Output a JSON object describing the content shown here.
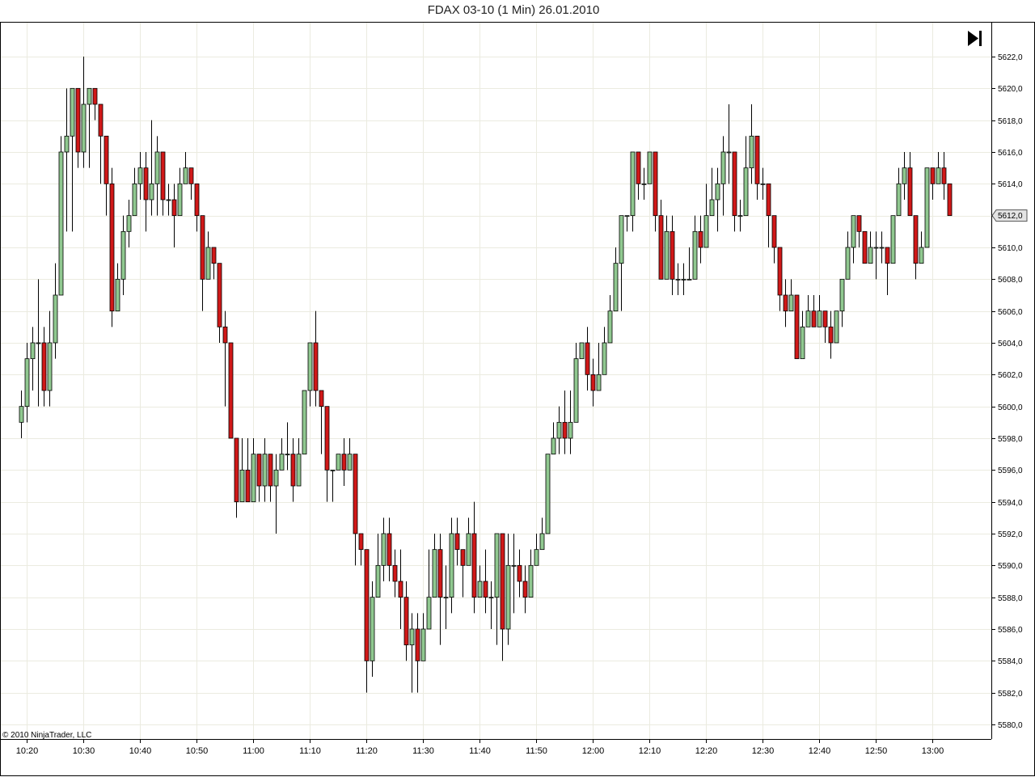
{
  "chart_data": {
    "type": "candlestick",
    "title": "FDAX 03-10 (1 Min)  26.01.2010",
    "copyright": "© 2010 NinjaTrader, LLC",
    "current_price_label": "5612,0",
    "current_price": 5612.0,
    "y_ticks": [
      "5580,0",
      "5582,0",
      "5584,0",
      "5586,0",
      "5588,0",
      "5590,0",
      "5592,0",
      "5594,0",
      "5596,0",
      "5598,0",
      "5600,0",
      "5602,0",
      "5604,0",
      "5606,0",
      "5608,0",
      "5610,0",
      "5612,0",
      "5614,0",
      "5616,0",
      "5618,0",
      "5620,0",
      "5622,0"
    ],
    "y_tick_values": [
      5580,
      5582,
      5584,
      5586,
      5588,
      5590,
      5592,
      5594,
      5596,
      5598,
      5600,
      5602,
      5604,
      5606,
      5608,
      5610,
      5612,
      5614,
      5616,
      5618,
      5620,
      5622
    ],
    "x_ticks": [
      "10:20",
      "10:30",
      "10:40",
      "10:50",
      "11:00",
      "11:10",
      "11:20",
      "11:30",
      "11:40",
      "11:50",
      "12:00",
      "12:10",
      "12:20",
      "12:30",
      "12:40",
      "12:50",
      "13:00"
    ],
    "x_tick_minutes": [
      620,
      630,
      640,
      650,
      660,
      670,
      680,
      690,
      700,
      710,
      720,
      730,
      740,
      750,
      760,
      770,
      780
    ],
    "ylim": [
      5579.5,
      5623.5
    ],
    "grid": true,
    "colors": {
      "up": "#90c890",
      "down": "#d01818",
      "wick": "#000000",
      "grid": "#ebebe0"
    },
    "candles": [
      [
        619,
        5599,
        5600,
        5598,
        5601
      ],
      [
        620,
        5600,
        5603,
        5599,
        5604
      ],
      [
        621,
        5603,
        5604,
        5601,
        5605
      ],
      [
        622,
        5604,
        5604,
        5600,
        5608
      ],
      [
        623,
        5604,
        5601,
        5600,
        5605
      ],
      [
        624,
        5601,
        5604,
        5600,
        5606
      ],
      [
        625,
        5604,
        5607,
        5603,
        5609
      ],
      [
        626,
        5607,
        5616,
        5607,
        5617
      ],
      [
        627,
        5616,
        5617,
        5611,
        5620
      ],
      [
        628,
        5617,
        5620,
        5611,
        5620
      ],
      [
        629,
        5620,
        5616,
        5615,
        5620
      ],
      [
        630,
        5616,
        5619,
        5615,
        5622
      ],
      [
        631,
        5619,
        5620,
        5615,
        5620
      ],
      [
        632,
        5620,
        5619,
        5618,
        5620
      ],
      [
        633,
        5619,
        5617,
        5614,
        5619
      ],
      [
        634,
        5617,
        5614,
        5612,
        5617
      ],
      [
        635,
        5614,
        5606,
        5605,
        5615
      ],
      [
        636,
        5606,
        5608,
        5606,
        5609
      ],
      [
        637,
        5608,
        5611,
        5607,
        5612
      ],
      [
        638,
        5611,
        5612,
        5610,
        5613
      ],
      [
        639,
        5612,
        5614,
        5612,
        5615
      ],
      [
        640,
        5614,
        5615,
        5613,
        5616
      ],
      [
        641,
        5615,
        5613,
        5611,
        5616
      ],
      [
        642,
        5613,
        5614,
        5612,
        5618
      ],
      [
        643,
        5614,
        5616,
        5612,
        5617
      ],
      [
        644,
        5616,
        5613,
        5612,
        5616
      ],
      [
        645,
        5613,
        5613,
        5612,
        5614
      ],
      [
        646,
        5613,
        5612,
        5610,
        5614
      ],
      [
        647,
        5612,
        5614,
        5613,
        5615
      ],
      [
        648,
        5614,
        5615,
        5614,
        5616
      ],
      [
        649,
        5615,
        5614,
        5613,
        5615
      ],
      [
        650,
        5614,
        5612,
        5611,
        5614
      ],
      [
        651,
        5612,
        5608,
        5606,
        5612
      ],
      [
        652,
        5608,
        5610,
        5608,
        5611
      ],
      [
        653,
        5610,
        5609,
        5608,
        5610
      ],
      [
        654,
        5609,
        5605,
        5604,
        5609
      ],
      [
        655,
        5605,
        5604,
        5600,
        5606
      ],
      [
        656,
        5604,
        5598,
        5598,
        5604
      ],
      [
        657,
        5598,
        5594,
        5593,
        5598
      ],
      [
        658,
        5594,
        5596,
        5595,
        5598
      ],
      [
        659,
        5596,
        5594,
        5594,
        5598
      ],
      [
        660,
        5594,
        5597,
        5595,
        5598
      ],
      [
        661,
        5597,
        5595,
        5594,
        5597
      ],
      [
        662,
        5595,
        5597,
        5594,
        5598
      ],
      [
        663,
        5597,
        5595,
        5594,
        5597
      ],
      [
        664,
        5595,
        5596,
        5592,
        5597
      ],
      [
        665,
        5596,
        5597,
        5596,
        5598
      ],
      [
        666,
        5597,
        5597,
        5596,
        5599
      ],
      [
        667,
        5597,
        5595,
        5594,
        5598
      ],
      [
        668,
        5595,
        5597,
        5595,
        5598
      ],
      [
        669,
        5597,
        5601,
        5597,
        5599
      ],
      [
        670,
        5601,
        5604,
        5600,
        5604
      ],
      [
        671,
        5604,
        5601,
        5600,
        5606
      ],
      [
        672,
        5601,
        5600,
        5597,
        5601
      ],
      [
        673,
        5600,
        5596,
        5594,
        5596
      ],
      [
        674,
        5596,
        5596,
        5594,
        5596
      ],
      [
        675,
        5596,
        5597,
        5596,
        5597
      ],
      [
        676,
        5597,
        5596,
        5595,
        5598
      ],
      [
        677,
        5596,
        5597,
        5596,
        5598
      ],
      [
        678,
        5597,
        5592,
        5590,
        5597
      ],
      [
        679,
        5592,
        5591,
        5590,
        5592
      ],
      [
        680,
        5591,
        5584,
        5582,
        5591
      ],
      [
        681,
        5584,
        5588,
        5583,
        5589
      ],
      [
        682,
        5588,
        5590,
        5588,
        5592
      ],
      [
        683,
        5590,
        5592,
        5589,
        5593
      ],
      [
        684,
        5592,
        5590,
        5589,
        5593
      ],
      [
        685,
        5590,
        5589,
        5588,
        5591
      ],
      [
        686,
        5589,
        5588,
        5586,
        5591
      ],
      [
        687,
        5588,
        5585,
        5584,
        5589
      ],
      [
        688,
        5585,
        5586,
        5582,
        5587
      ],
      [
        689,
        5586,
        5584,
        5582,
        5587
      ],
      [
        690,
        5584,
        5586,
        5585,
        5587
      ],
      [
        691,
        5586,
        5588,
        5586,
        5591
      ],
      [
        692,
        5588,
        5591,
        5588,
        5592
      ],
      [
        693,
        5591,
        5588,
        5585,
        5592
      ],
      [
        694,
        5588,
        5588,
        5586,
        5590
      ],
      [
        695,
        5588,
        5592,
        5587,
        5593
      ],
      [
        696,
        5592,
        5591,
        5590,
        5593
      ],
      [
        697,
        5591,
        5590,
        5588,
        5591
      ],
      [
        698,
        5590,
        5592,
        5590,
        5593
      ],
      [
        699,
        5592,
        5588,
        5587,
        5594
      ],
      [
        700,
        5588,
        5589,
        5588,
        5590
      ],
      [
        701,
        5589,
        5588,
        5587,
        5591
      ],
      [
        702,
        5588,
        5588,
        5586,
        5589
      ],
      [
        703,
        5588,
        5592,
        5585,
        5592
      ],
      [
        704,
        5592,
        5586,
        5584,
        5591
      ],
      [
        705,
        5586,
        5590,
        5585,
        5592
      ],
      [
        706,
        5590,
        5590,
        5587,
        5592
      ],
      [
        707,
        5590,
        5589,
        5588,
        5591
      ],
      [
        708,
        5589,
        5588,
        5587,
        5590
      ],
      [
        709,
        5588,
        5590,
        5589,
        5591
      ],
      [
        710,
        5590,
        5591,
        5590,
        5592
      ],
      [
        711,
        5591,
        5592,
        5591,
        5593
      ],
      [
        712,
        5592,
        5597,
        5592,
        5597
      ],
      [
        713,
        5597,
        5598,
        5597,
        5599
      ],
      [
        714,
        5598,
        5599,
        5597,
        5600
      ],
      [
        715,
        5599,
        5598,
        5597,
        5601
      ],
      [
        716,
        5598,
        5599,
        5597,
        5601
      ],
      [
        717,
        5599,
        5603,
        5599,
        5604
      ],
      [
        718,
        5603,
        5604,
        5603,
        5604
      ],
      [
        719,
        5604,
        5602,
        5601,
        5605
      ],
      [
        720,
        5602,
        5601,
        5600,
        5603
      ],
      [
        721,
        5601,
        5602,
        5601,
        5604
      ],
      [
        722,
        5602,
        5604,
        5603,
        5605
      ],
      [
        723,
        5604,
        5606,
        5605,
        5607
      ],
      [
        724,
        5606,
        5609,
        5606,
        5610
      ],
      [
        725,
        5609,
        5612,
        5606,
        5610
      ],
      [
        726,
        5612,
        5612,
        5611,
        5612
      ],
      [
        727,
        5612,
        5616,
        5611,
        5616
      ],
      [
        728,
        5616,
        5614,
        5613,
        5616
      ],
      [
        729,
        5614,
        5614,
        5613,
        5615
      ],
      [
        730,
        5614,
        5616,
        5614,
        5616
      ],
      [
        731,
        5616,
        5612,
        5611,
        5616
      ],
      [
        732,
        5612,
        5608,
        5609,
        5613
      ],
      [
        733,
        5608,
        5611,
        5610,
        5612
      ],
      [
        734,
        5611,
        5608,
        5607,
        5612
      ],
      [
        735,
        5608,
        5608,
        5607,
        5609
      ],
      [
        736,
        5608,
        5608,
        5607,
        5609
      ],
      [
        737,
        5608,
        5608,
        5608,
        5610
      ],
      [
        738,
        5608,
        5611,
        5609,
        5612
      ],
      [
        739,
        5611,
        5610,
        5609,
        5612
      ],
      [
        740,
        5610,
        5612,
        5610,
        5614
      ],
      [
        741,
        5612,
        5613,
        5612,
        5615
      ],
      [
        742,
        5613,
        5614,
        5611,
        5615
      ],
      [
        743,
        5614,
        5616,
        5612,
        5617
      ],
      [
        744,
        5616,
        5616,
        5614,
        5619
      ],
      [
        745,
        5616,
        5612,
        5611,
        5616
      ],
      [
        746,
        5612,
        5612,
        5611,
        5613
      ],
      [
        747,
        5612,
        5615,
        5612,
        5617
      ],
      [
        748,
        5615,
        5617,
        5614,
        5619
      ],
      [
        749,
        5617,
        5614,
        5613,
        5616
      ],
      [
        750,
        5614,
        5614,
        5613,
        5615
      ],
      [
        751,
        5614,
        5612,
        5610,
        5614
      ],
      [
        752,
        5612,
        5610,
        5609,
        5611
      ],
      [
        753,
        5610,
        5607,
        5606,
        5610
      ],
      [
        754,
        5607,
        5606,
        5605,
        5608
      ],
      [
        755,
        5606,
        5607,
        5606,
        5608
      ],
      [
        756,
        5607,
        5603,
        5603,
        5606
      ],
      [
        757,
        5603,
        5605,
        5603,
        5606
      ],
      [
        758,
        5605,
        5606,
        5605,
        5607
      ],
      [
        759,
        5606,
        5605,
        5605,
        5607
      ],
      [
        760,
        5605,
        5606,
        5605,
        5607
      ],
      [
        761,
        5606,
        5605,
        5604,
        5606
      ],
      [
        762,
        5605,
        5604,
        5603,
        5606
      ],
      [
        763,
        5604,
        5606,
        5604,
        5606
      ],
      [
        764,
        5606,
        5608,
        5605,
        5608
      ],
      [
        765,
        5608,
        5610,
        5608,
        5611
      ],
      [
        766,
        5610,
        5612,
        5609,
        5612
      ],
      [
        767,
        5612,
        5611,
        5610,
        5612
      ],
      [
        768,
        5611,
        5609,
        5609,
        5611
      ],
      [
        769,
        5609,
        5610,
        5609,
        5611
      ],
      [
        770,
        5610,
        5610,
        5608,
        5611
      ],
      [
        771,
        5610,
        5610,
        5609,
        5611
      ],
      [
        772,
        5610,
        5609,
        5607,
        5610
      ],
      [
        773,
        5609,
        5612,
        5609,
        5612
      ],
      [
        774,
        5612,
        5614,
        5612,
        5615
      ],
      [
        775,
        5614,
        5615,
        5613,
        5616
      ],
      [
        776,
        5615,
        5612,
        5612,
        5616
      ],
      [
        777,
        5612,
        5609,
        5608,
        5612
      ],
      [
        778,
        5609,
        5610,
        5609,
        5611
      ],
      [
        779,
        5610,
        5615,
        5610,
        5615
      ],
      [
        780,
        5615,
        5614,
        5613,
        5615
      ],
      [
        781,
        5614,
        5615,
        5614,
        5616
      ],
      [
        782,
        5615,
        5614,
        5613,
        5616
      ],
      [
        783,
        5614,
        5612,
        5612,
        5614
      ]
    ]
  }
}
